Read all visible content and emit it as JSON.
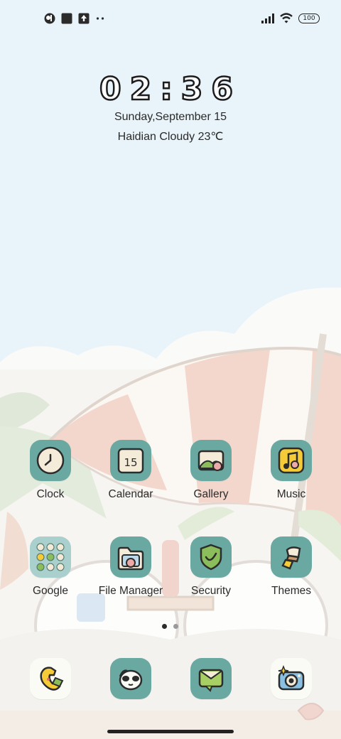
{
  "status_bar": {
    "left_icons": [
      "app-notification-icon",
      "square-notification-icon",
      "upload-icon",
      "more-dots-icon"
    ],
    "right_icons": [
      "signal-icon",
      "wifi-icon",
      "battery-icon"
    ],
    "battery_level": "100"
  },
  "lockclock": {
    "time": "02:36",
    "date": "Sunday,September 15",
    "weather": "Haidian Cloudy 23℃"
  },
  "apps": [
    {
      "label": "Clock",
      "icon": "clock-icon"
    },
    {
      "label": "Calendar",
      "icon": "calendar-icon",
      "icon_text": "15"
    },
    {
      "label": "Gallery",
      "icon": "gallery-icon"
    },
    {
      "label": "Music",
      "icon": "music-icon"
    },
    {
      "label": "Google",
      "icon": "google-folder-icon"
    },
    {
      "label": "File Manager",
      "icon": "file-manager-icon"
    },
    {
      "label": "Security",
      "icon": "security-shield-icon"
    },
    {
      "label": "Themes",
      "icon": "themes-icon"
    }
  ],
  "page_indicator": {
    "pages": 2,
    "current": 1
  },
  "dock": [
    {
      "name": "phone",
      "icon": "phone-icon"
    },
    {
      "name": "contacts",
      "icon": "contacts-panda-icon"
    },
    {
      "name": "messages",
      "icon": "messages-icon"
    },
    {
      "name": "camera",
      "icon": "camera-icon"
    }
  ],
  "colors": {
    "sky": "#e9f4fa",
    "icon_teal": "#6aa9a2",
    "umbrella_pink": "#f3cfc2",
    "text": "#2b2b2b"
  }
}
